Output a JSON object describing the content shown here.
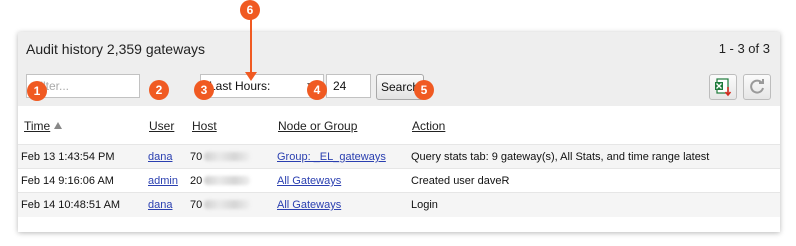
{
  "panel": {
    "title": "Audit history 2,359 gateways",
    "pager": "1 - 3 of 3"
  },
  "filters": {
    "text_placeholder": "Filter...",
    "time_select": "Last Hours:",
    "hours_value": "24",
    "search_label": "Search"
  },
  "toolbar": {
    "export_icon": "excel-export-icon",
    "refresh_icon": "refresh-icon"
  },
  "table": {
    "headers": {
      "time": "Time",
      "user": "User",
      "host": "Host",
      "node": "Node or Group",
      "action": "Action"
    },
    "rows": [
      {
        "time": "Feb 13 1:43:54 PM",
        "user": "dana",
        "host": "70",
        "node": "Group: _EL_gateways",
        "action": "Query stats tab: 9 gateway(s), All Stats, and time range latest"
      },
      {
        "time": "Feb 14 9:16:06 AM",
        "user": "admin",
        "host": "20",
        "node": "All Gateways",
        "action": "Created user daveR"
      },
      {
        "time": "Feb 14 10:48:51 AM",
        "user": "dana",
        "host": "70",
        "node": "All Gateways",
        "action": "Login"
      }
    ]
  },
  "callouts": [
    "1",
    "2",
    "3",
    "4",
    "5",
    "6"
  ],
  "colors": {
    "callout": "#f05a22",
    "link": "#2a3fb0",
    "panel_bg": "#eeeeee",
    "excel_green": "#1d7a3a",
    "arrow_red": "#d42a1e"
  }
}
